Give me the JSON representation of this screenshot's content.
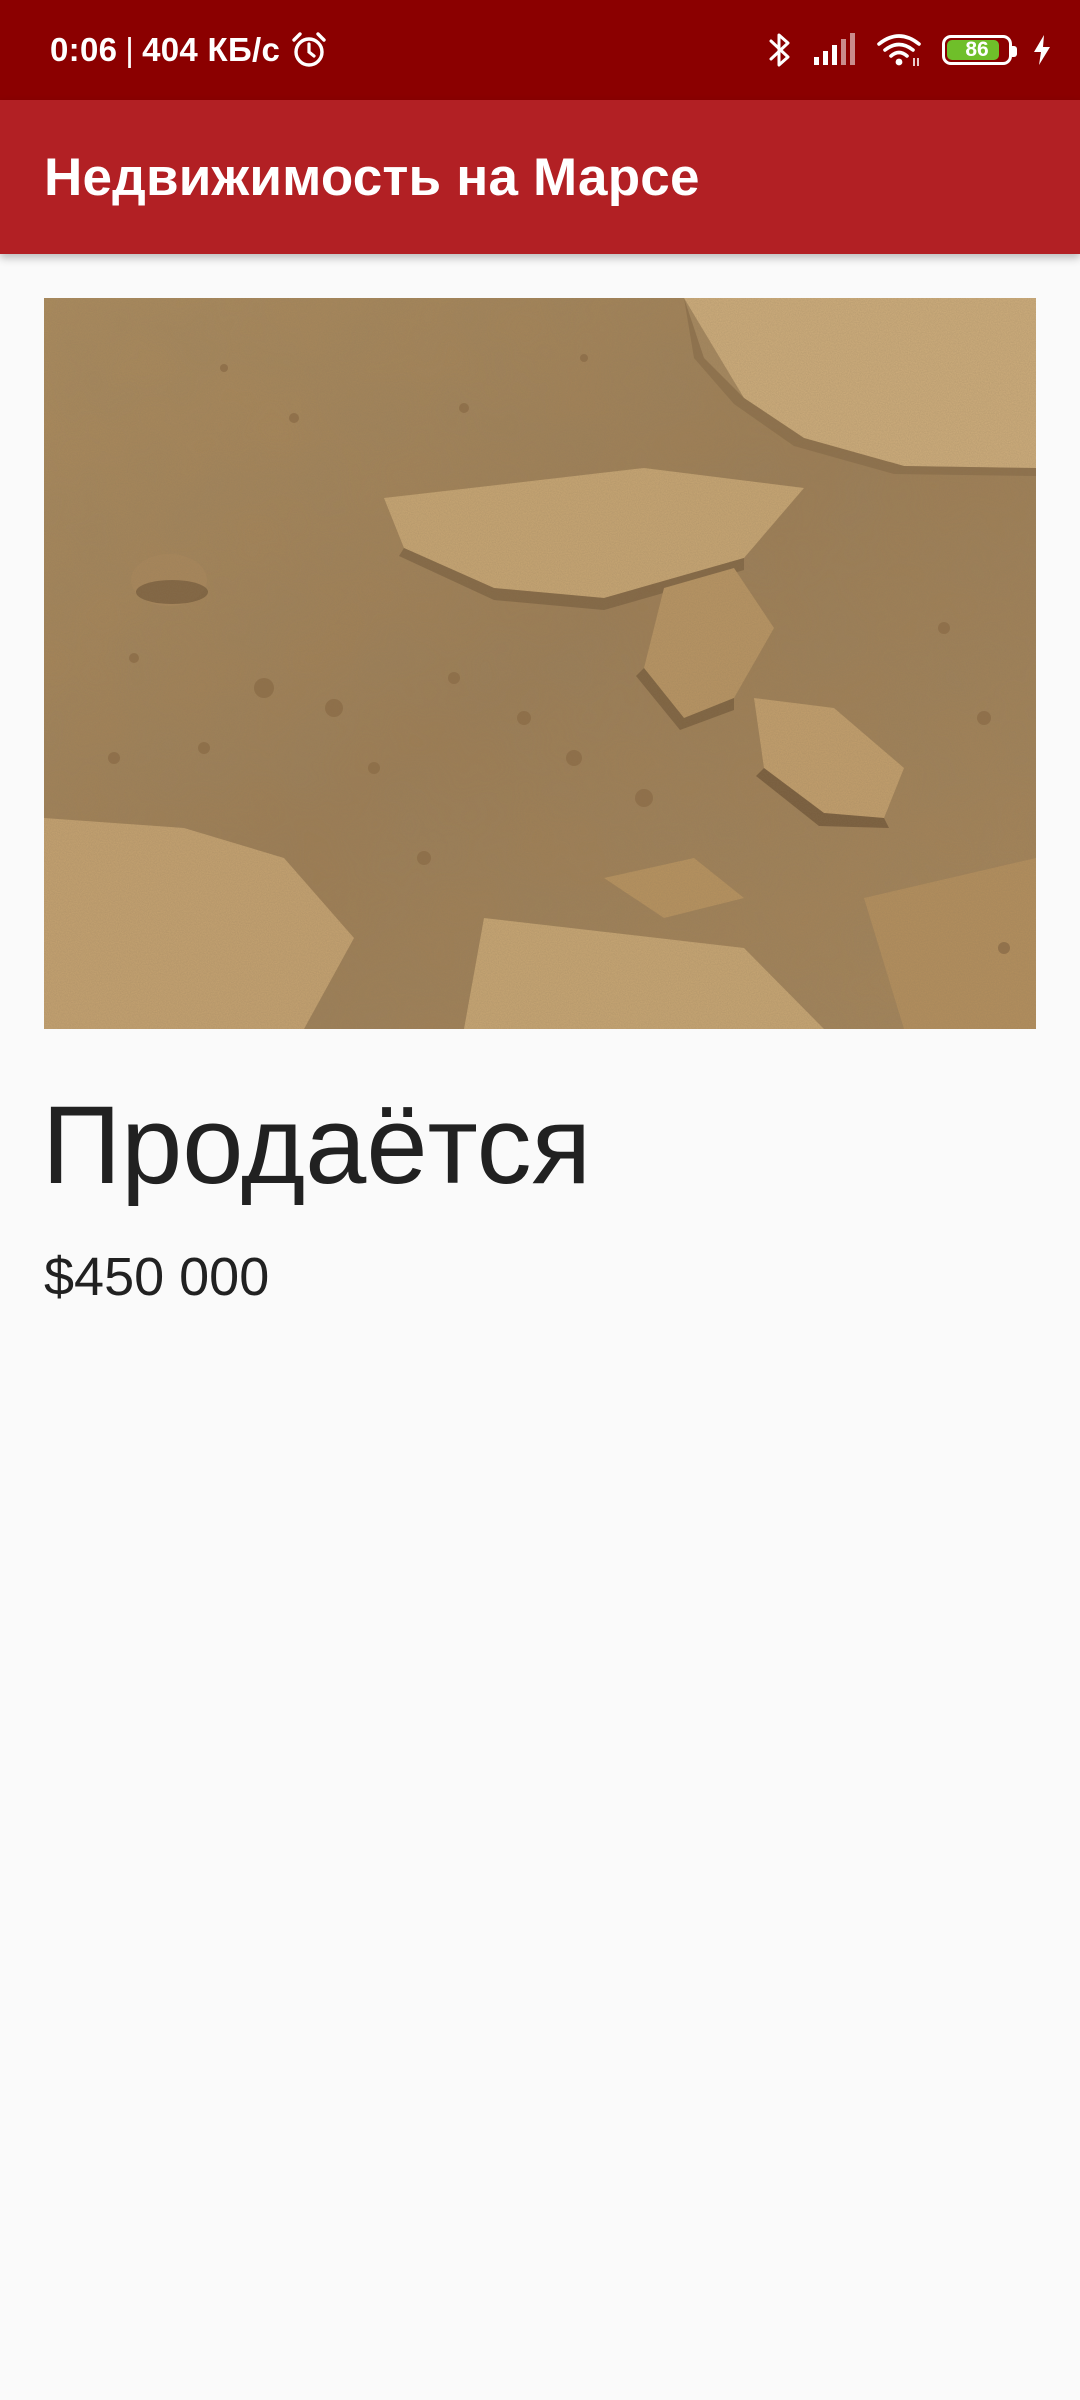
{
  "status_bar": {
    "time": "0:06",
    "separator": "|",
    "network_speed": "404 КБ/с",
    "battery_level": "86",
    "battery_fraction": 0.86,
    "icons": [
      "alarm-icon",
      "bluetooth-icon",
      "signal-icon",
      "wifi-icon",
      "battery-icon",
      "charging-icon"
    ]
  },
  "app_bar": {
    "title": "Недвижимость на Марсе"
  },
  "listing": {
    "status": "Продаётся",
    "price": "$450 000"
  },
  "colors": {
    "status_bar_bg": "#8b0000",
    "app_bar_bg": "#b22024",
    "page_bg": "#fafafa",
    "text_primary": "#212121",
    "battery_fill": "#6fbf2a"
  }
}
